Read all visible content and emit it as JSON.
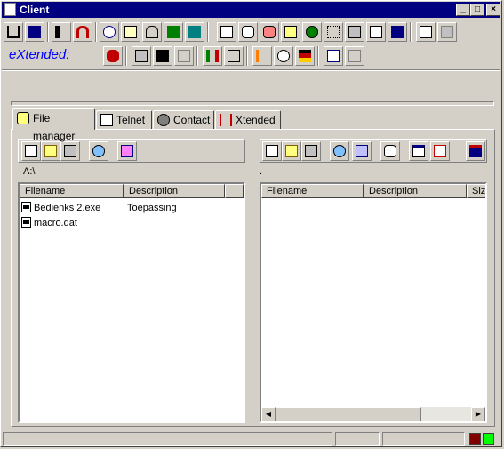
{
  "window": {
    "title": "Client",
    "buttons": {
      "minimize": "_",
      "maximize": "□",
      "close": "×"
    }
  },
  "toolbar_extended": {
    "label": "eXtended:"
  },
  "tabs": [
    {
      "label": "File manager",
      "icon": "magnifier-folder-icon",
      "active": true
    },
    {
      "label": "Telnet",
      "icon": "terminal-icon",
      "active": false
    },
    {
      "label": "Contact",
      "icon": "contact-icon",
      "active": false
    },
    {
      "label": "Xtended",
      "icon": "xtended-icon",
      "active": false
    }
  ],
  "left_panel": {
    "path": "A:\\",
    "columns": [
      "Filename",
      "Description",
      ""
    ],
    "rows": [
      {
        "filename": "Bedienks 2.exe",
        "description": "Toepassing"
      },
      {
        "filename": "macro.dat",
        "description": ""
      }
    ]
  },
  "right_panel": {
    "path": ".",
    "columns": [
      "Filename",
      "Description",
      "Siz"
    ]
  },
  "colors": {
    "titlebar": "#000080",
    "face": "#d4d0c8",
    "extended_label": "#0000ff",
    "status_dark": "#800000",
    "status_green": "#00ff00"
  }
}
